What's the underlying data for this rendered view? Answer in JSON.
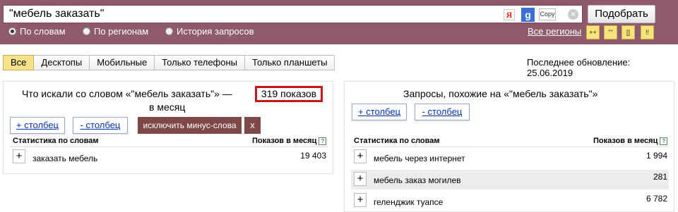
{
  "search": {
    "query": "\"мебель заказать\"",
    "ya_label": "Я",
    "g_label": "g",
    "copy_label": "Copy",
    "clear_label": "×",
    "submit_label": "Подобрать"
  },
  "modes": [
    {
      "label": "По словам",
      "selected": true
    },
    {
      "label": "По регионам",
      "selected": false
    },
    {
      "label": "История запросов",
      "selected": false
    }
  ],
  "regions_link": "Все регионы",
  "mini_buttons": [
    "++",
    "\"\"",
    "[]",
    "!!"
  ],
  "colors": {
    "header": "#8f5a6e",
    "accent": "#f6e28b",
    "exclude_button": "#7e4848",
    "highlight_border": "#c41818"
  },
  "tabs": [
    {
      "label": "Все",
      "active": true
    },
    {
      "label": "Десктопы",
      "active": false
    },
    {
      "label": "Мобильные",
      "active": false
    },
    {
      "label": "Только телефоны",
      "active": false
    },
    {
      "label": "Только планшеты",
      "active": false
    }
  ],
  "last_update": "Последнее обновление: 25.06.2019",
  "left": {
    "title_line1": "Что искали со словом «\"мебель заказать\"» —",
    "shows": "319 показов",
    "title_line2": "в месяц",
    "add_col": "+ столбец",
    "remove_col": "- столбец",
    "exclude_label": "исключить минус-слова",
    "exclude_x": "x",
    "col_words": "Статистика по словам",
    "col_shows": "Показов в месяц",
    "help": "?",
    "rows": [
      {
        "word": "заказать мебель",
        "count": "19 403"
      }
    ]
  },
  "right": {
    "title": "Запросы, похожие на «\"мебель заказать\"»",
    "add_col": "+ столбец",
    "remove_col": "- столбец",
    "col_words": "Статистика по словам",
    "col_shows": "Показов в месяц",
    "help": "?",
    "rows": [
      {
        "word": "мебель через интернет",
        "count": "1 994"
      },
      {
        "word": "мебель заказ могилев",
        "count": "281"
      },
      {
        "word": "геленджик туапсе",
        "count": "6 782"
      }
    ]
  },
  "plus_label": "+"
}
